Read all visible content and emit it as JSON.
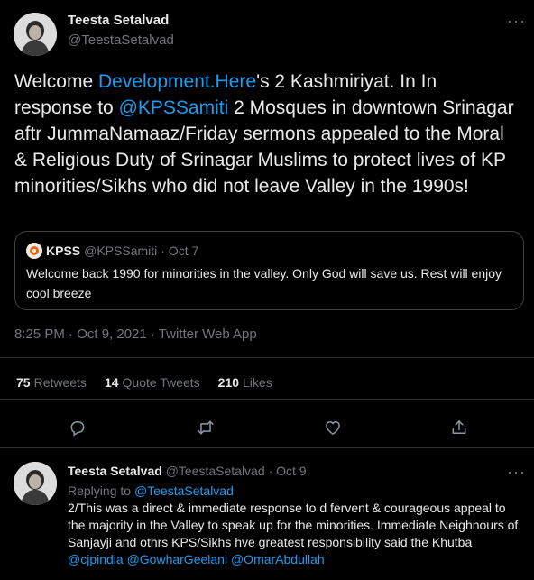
{
  "main_tweet": {
    "author_name": "Teesta Setalvad",
    "author_handle": "@TeestaSetalvad",
    "text_part1": "Welcome ",
    "text_link1": "Development.Here",
    "text_part2": "'s 2 Kashmiriyat. In In response to ",
    "text_link2": "@KPSSamiti",
    "text_part3": " 2 Mosques in downtown Srinagar aftr JummaNamaaz/Friday sermons appealed to the Moral & Religious Duty of Srinagar Muslims to protect lives of KP minorities/Sikhs who did not leave Valley in the 1990s!",
    "timestamp": "8:25 PM · Oct 9, 2021 · Twitter Web App"
  },
  "quoted_tweet": {
    "author_name": "KPSS",
    "author_handle": "@KPSSamiti",
    "date": "· Oct 7",
    "text": "Welcome back 1990 for minorities in the valley. Only God will save us. Rest will enjoy   cool breeze"
  },
  "stats": {
    "retweets_count": "75",
    "retweets_label": "Retweets",
    "quotes_count": "14",
    "quotes_label": "Quote Tweets",
    "likes_count": "210",
    "likes_label": "Likes"
  },
  "actions": {
    "icons": [
      "reply-icon",
      "retweet-icon",
      "like-icon",
      "share-icon"
    ]
  },
  "reply_tweet": {
    "author_name": "Teesta Setalvad",
    "author_handle": "@TeestaSetalvad",
    "date": "· Oct 9",
    "replying_label": "Replying to ",
    "replying_to": "@TeestaSetalvad",
    "text": "2/This was a direct & immediate response to d fervent & courageous appeal to the majority in the Valley to speak up for the minorities. Immediate Neighnours of Sanjayji and othrs KPS/Sikhs hve greatest responsibility said the Khutba ",
    "mention1": "@cjpindia",
    "mention2": "@GowharGeelani",
    "mention3": "@OmarAbdullah"
  },
  "colors": {
    "background": "#000000",
    "text": "#e7e9ea",
    "muted": "#71767b",
    "link": "#1d9bf0",
    "border": "#2f3336"
  }
}
